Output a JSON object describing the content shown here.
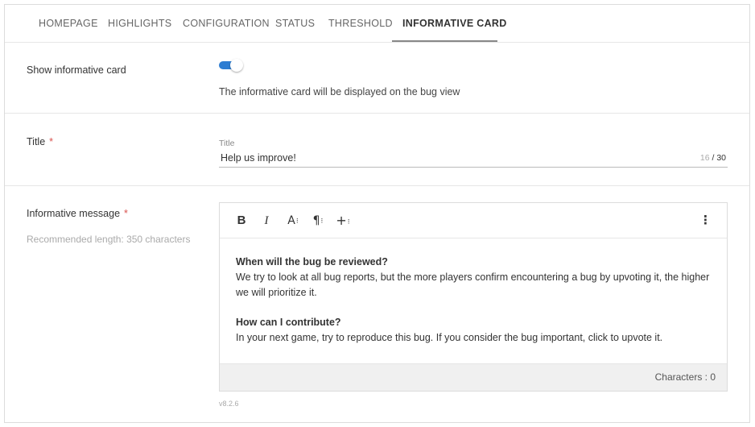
{
  "tabs": [
    {
      "label": "HOMEPAGE",
      "active": false
    },
    {
      "label": "HIGHLIGHTS",
      "active": false
    },
    {
      "label": "CONFIGURATION",
      "active": false
    },
    {
      "label": "STATUS",
      "active": false
    },
    {
      "label": "THRESHOLD",
      "active": false
    },
    {
      "label": "INFORMATIVE CARD",
      "active": true
    }
  ],
  "show_card": {
    "label": "Show informative card",
    "enabled": true,
    "description": "The informative card will be displayed on the bug view"
  },
  "title_field": {
    "label": "Title",
    "required_mark": "*",
    "caption": "Title",
    "value": "Help us improve!",
    "count": "16",
    "max": "/ 30"
  },
  "message": {
    "label": "Informative message",
    "required_mark": "*",
    "hint": "Recommended length: 350 characters",
    "toolbar": {
      "bold": "B",
      "italic": "I",
      "font": "A",
      "paragraph": "¶",
      "insert": "+",
      "more": "⋮"
    },
    "content": {
      "q1": "When will the bug be reviewed?",
      "a1": "We try to look at all bug reports, but the more players confirm encountering a bug by upvoting it, the higher we will prioritize it.",
      "q2": "How can I contribute?",
      "a2": "In your next game, try to reproduce this bug. If you consider the bug important, click to upvote it."
    },
    "characters": "Characters : 0"
  },
  "version": "v8.2.6",
  "colors": {
    "toggle_accent": "#2d7dd2",
    "required": "#d9534f"
  }
}
